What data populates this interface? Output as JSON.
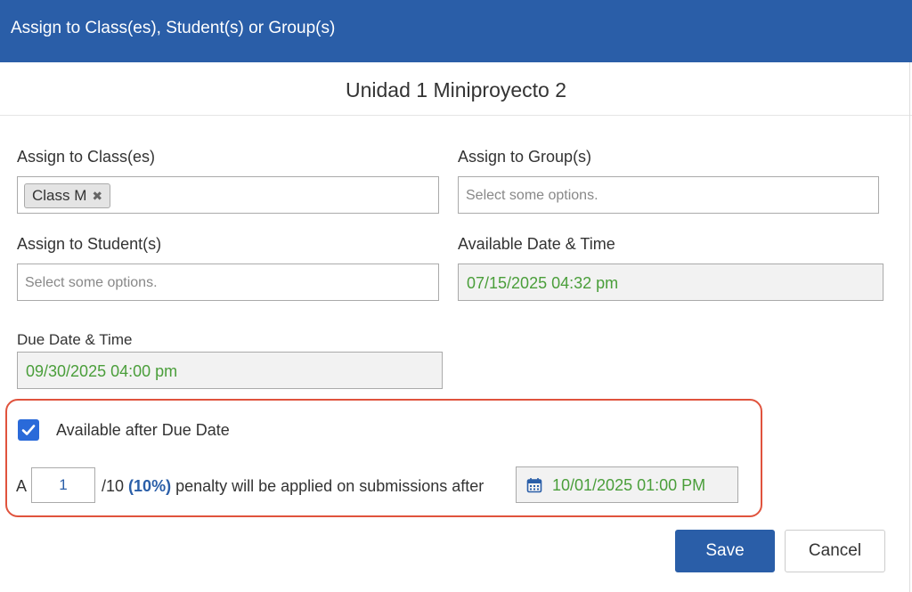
{
  "dialog": {
    "title": "Assign to Class(es), Student(s) or Group(s)",
    "assignment_name": "Unidad 1 Miniproyecto 2"
  },
  "form": {
    "classes": {
      "label": "Assign to Class(es)",
      "selected": [
        "Class M"
      ],
      "remove_symbol": "✖"
    },
    "groups": {
      "label": "Assign to Group(s)",
      "placeholder": "Select some options."
    },
    "students": {
      "label": "Assign to Student(s)",
      "placeholder": "Select some options."
    },
    "available_date": {
      "label": "Available Date & Time",
      "value": "07/15/2025 04:32 pm"
    },
    "due_date": {
      "label": "Due Date & Time",
      "value": "09/30/2025 04:00 pm"
    }
  },
  "late_policy": {
    "checkbox_checked": true,
    "checkbox_label": "Available after Due Date",
    "prefix": "A",
    "penalty_value": "1",
    "out_of": "/10",
    "percent": "(10%)",
    "suffix": "penalty will be applied on submissions after",
    "late_date": "10/01/2025 01:00 PM",
    "late_date_icon": "calendar-icon"
  },
  "actions": {
    "save_label": "Save",
    "cancel_label": "Cancel"
  },
  "colors": {
    "header": "#2a5ea8",
    "date_text": "#4a9e3a",
    "highlight_border": "#e0533d",
    "checkbox": "#2a6ad9"
  }
}
